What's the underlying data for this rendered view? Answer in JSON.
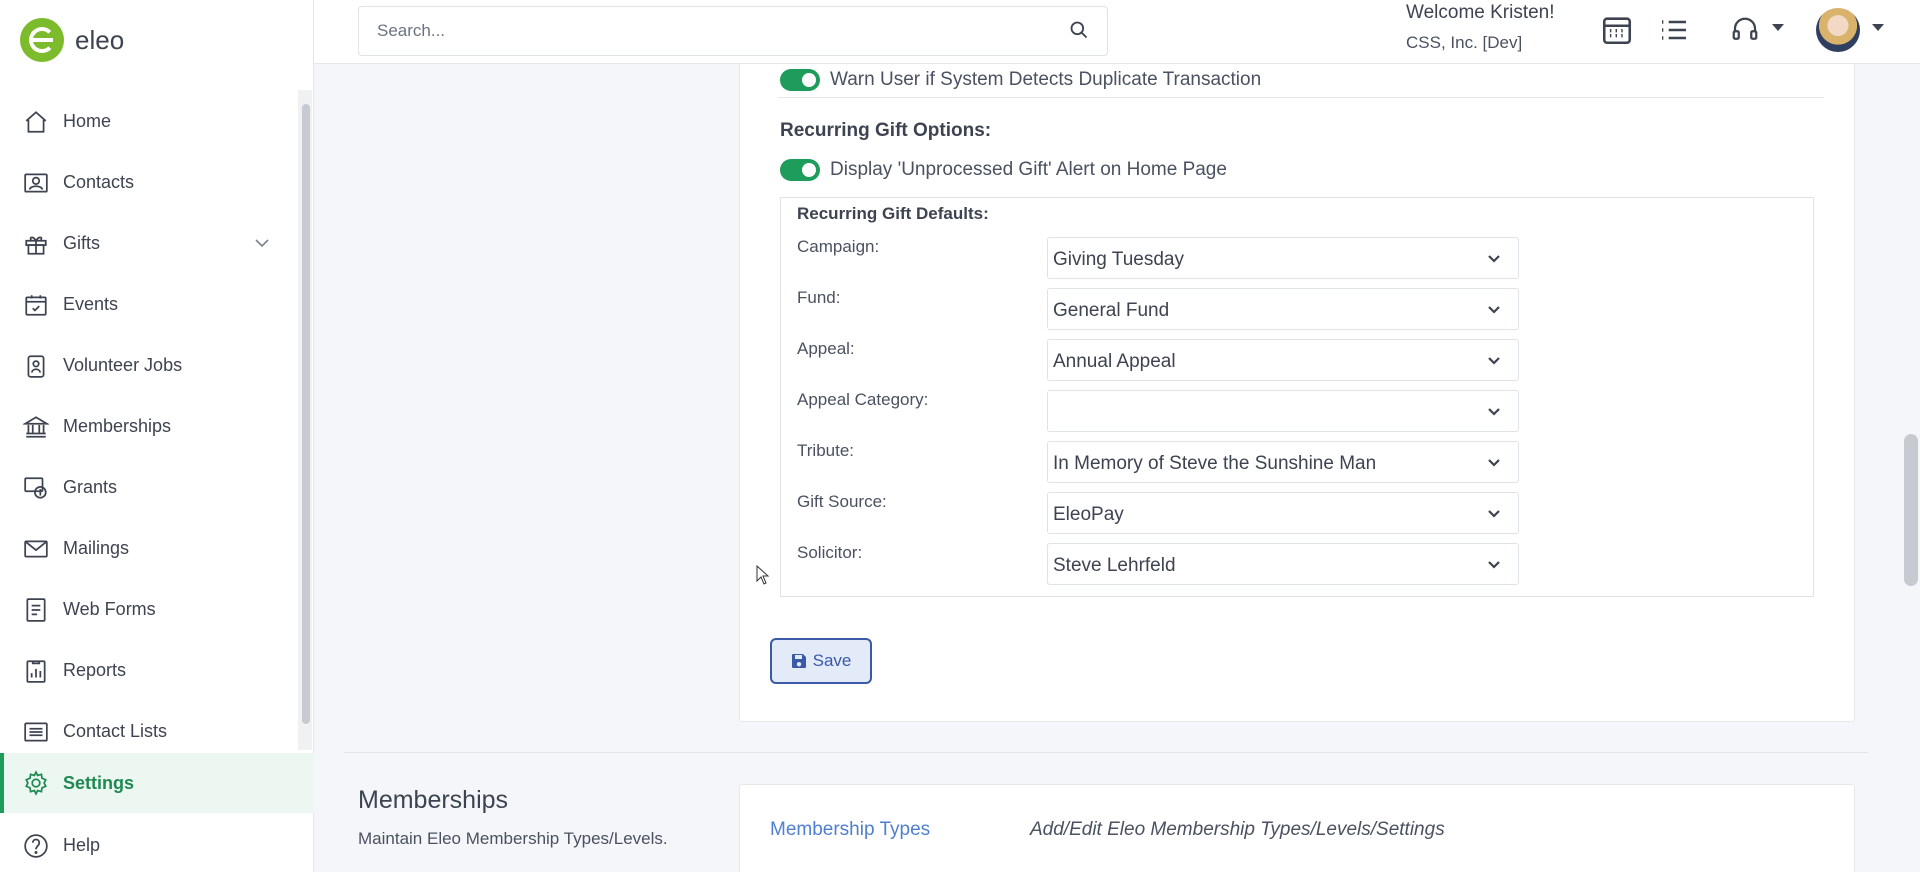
{
  "app": {
    "logo_text": "eleo"
  },
  "header": {
    "search_placeholder": "Search...",
    "welcome": "Welcome Kristen!",
    "org": "CSS, Inc. [Dev]"
  },
  "sidebar": {
    "items": [
      {
        "label": "Home",
        "icon": "home-icon"
      },
      {
        "label": "Contacts",
        "icon": "contacts-icon"
      },
      {
        "label": "Gifts",
        "icon": "gift-icon"
      },
      {
        "label": "Events",
        "icon": "calendar-check-icon"
      },
      {
        "label": "Volunteer Jobs",
        "icon": "badge-icon"
      },
      {
        "label": "Memberships",
        "icon": "bank-icon"
      },
      {
        "label": "Grants",
        "icon": "grant-icon"
      },
      {
        "label": "Mailings",
        "icon": "mail-icon"
      },
      {
        "label": "Web Forms",
        "icon": "form-icon"
      },
      {
        "label": "Reports",
        "icon": "report-icon"
      },
      {
        "label": "Contact Lists",
        "icon": "list-icon"
      }
    ],
    "settings_label": "Settings",
    "help_label": "Help"
  },
  "settings": {
    "duplicate_warning": "Warn User if System Detects Duplicate Transaction",
    "recurring_title": "Recurring Gift Options:",
    "unprocessed_alert": "Display 'Unprocessed Gift' Alert on Home Page",
    "defaults_title": "Recurring Gift Defaults:",
    "fields": [
      {
        "label": "Campaign:",
        "value": "Giving Tuesday"
      },
      {
        "label": "Fund:",
        "value": "General Fund"
      },
      {
        "label": "Appeal:",
        "value": "Annual Appeal"
      },
      {
        "label": "Appeal Category:",
        "value": ""
      },
      {
        "label": "Tribute:",
        "value": "In Memory of Steve the Sunshine Man"
      },
      {
        "label": "Gift Source:",
        "value": "EleoPay"
      },
      {
        "label": "Solicitor:",
        "value": "Steve Lehrfeld"
      }
    ],
    "save_label": "Save"
  },
  "memberships_section": {
    "title": "Memberships",
    "description": "Maintain Eleo Membership Types/Levels.",
    "link_label": "Membership Types",
    "link_description": "Add/Edit Eleo Membership Types/Levels/Settings"
  },
  "colors": {
    "accent_green": "#1e9c5c",
    "link_blue": "#4f7fd0",
    "save_blue": "#3a5aa8"
  }
}
